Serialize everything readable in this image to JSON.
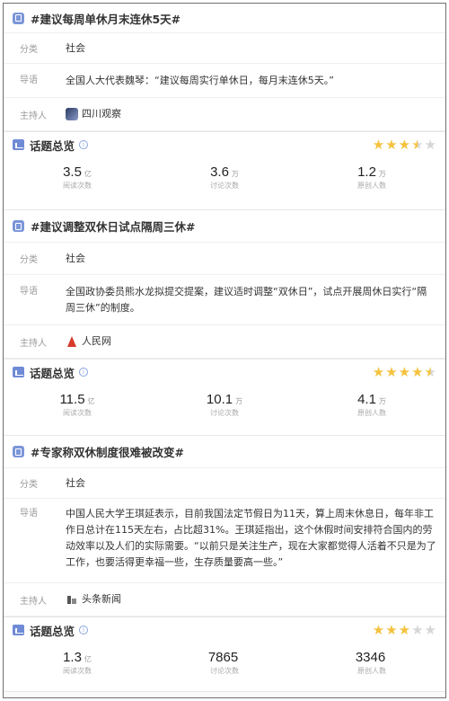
{
  "topics": [
    {
      "title": "#建议每周单休月末连休5天#",
      "category_label": "分类",
      "category": "社会",
      "intro_label": "导语",
      "intro": "全国人大代表魏琴：“建议每周实行单休日，每月末连休5天。”",
      "host_label": "主持人",
      "host": "四川观察",
      "host_icon": "sichuan-avatar-icon",
      "overview": {
        "title": "话题总览",
        "rating": 3.5,
        "stats": [
          {
            "value": "3.5",
            "unit": "亿",
            "label": "阅读次数"
          },
          {
            "value": "3.6",
            "unit": "万",
            "label": "讨论次数"
          },
          {
            "value": "1.2",
            "unit": "万",
            "label": "原创人数"
          }
        ]
      }
    },
    {
      "title": "#建议调整双休日试点隔周三休#",
      "category_label": "分类",
      "category": "社会",
      "intro_label": "导语",
      "intro": "全国政协委员熊水龙拟提交提案，建议适时调整“双休日”，试点开展周休日实行“隔周三休”的制度。",
      "host_label": "主持人",
      "host": "人民网",
      "host_icon": "renmin-logo-icon",
      "overview": {
        "title": "话题总览",
        "rating": 4.5,
        "stats": [
          {
            "value": "11.5",
            "unit": "亿",
            "label": "阅读次数"
          },
          {
            "value": "10.1",
            "unit": "万",
            "label": "讨论次数"
          },
          {
            "value": "4.1",
            "unit": "万",
            "label": "原创人数"
          }
        ]
      }
    },
    {
      "title": "#专家称双休制度很难被改变#",
      "category_label": "分类",
      "category": "社会",
      "intro_label": "导语",
      "intro": "中国人民大学王琪延表示，目前我国法定节假日为11天，算上周末休息日，每年非工作日总计在115天左右，占比超31%。王琪延指出，这个休假时间安排符合国内的劳动效率以及人们的实际需要。“以前只是关注生产，现在大家都觉得人活着不只是为了工作，也要活得更幸福一些，生存质量要高一些。”",
      "host_label": "主持人",
      "host": "头条新闻",
      "host_icon": "toutiao-logo-icon",
      "overview": {
        "title": "话题总览",
        "rating": 3,
        "stats": [
          {
            "value": "1.3",
            "unit": "亿",
            "label": "阅读次数"
          },
          {
            "value": "7865",
            "unit": "",
            "label": "讨论次数"
          },
          {
            "value": "3346",
            "unit": "",
            "label": "原创人数"
          }
        ]
      }
    }
  ],
  "colors": {
    "star_on": "#f4c23e",
    "star_off": "#d6d6d6",
    "icon_blue": "#7b96d8"
  }
}
